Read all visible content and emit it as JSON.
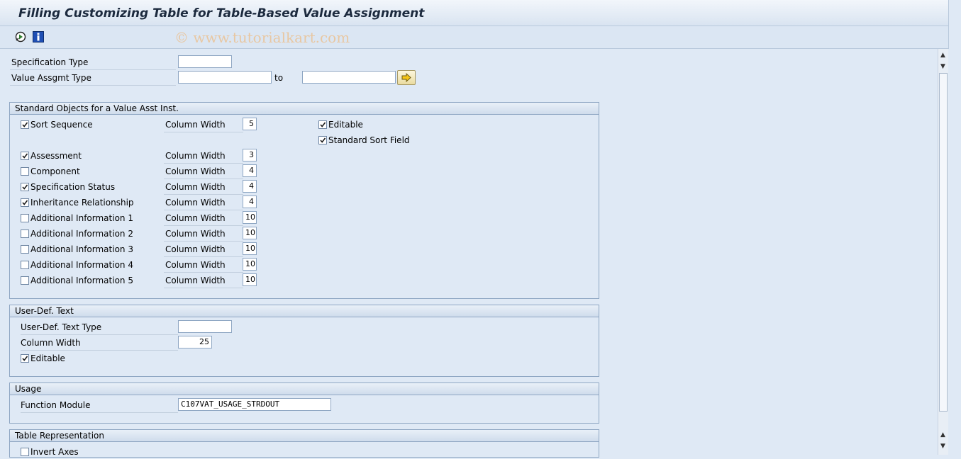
{
  "title": "Filling Customizing Table for Table-Based Value Assignment",
  "watermark": "© www.tutorialkart.com",
  "toolbar": {
    "icons": [
      "execute-icon",
      "info-icon"
    ]
  },
  "selection": {
    "spec_type_label": "Specification Type",
    "spec_type_value": "",
    "value_assgmt_label": "Value Assgmt Type",
    "value_assgmt_from": "",
    "to_label": "to",
    "value_assgmt_to": ""
  },
  "standard_objects": {
    "heading": "Standard Objects for a Value Asst Inst.",
    "col_width_label": "Column Width",
    "editable_label": "Editable",
    "editable_checked": true,
    "std_sort_label": "Standard Sort Field",
    "std_sort_checked": true,
    "items": [
      {
        "label": "Sort Sequence",
        "checked": true,
        "width": "5"
      },
      {
        "label": "Assessment",
        "checked": true,
        "width": "3"
      },
      {
        "label": "Component",
        "checked": false,
        "width": "4"
      },
      {
        "label": "Specification Status",
        "checked": true,
        "width": "4"
      },
      {
        "label": "Inheritance Relationship",
        "checked": true,
        "width": "4"
      },
      {
        "label": "Additional Information 1",
        "checked": false,
        "width": "10"
      },
      {
        "label": "Additional Information 2",
        "checked": false,
        "width": "10"
      },
      {
        "label": "Additional Information 3",
        "checked": false,
        "width": "10"
      },
      {
        "label": "Additional Information 4",
        "checked": false,
        "width": "10"
      },
      {
        "label": "Additional Information 5",
        "checked": false,
        "width": "10"
      }
    ]
  },
  "user_text": {
    "heading": "User-Def. Text",
    "type_label": "User-Def. Text Type",
    "type_value": "",
    "width_label": "Column Width",
    "width_value": "25",
    "editable_label": "Editable",
    "editable_checked": true
  },
  "usage": {
    "heading": "Usage",
    "fm_label": "Function Module",
    "fm_value": "C107VAT_USAGE_STRDOUT"
  },
  "table_rep": {
    "heading": "Table Representation",
    "invert_label": "Invert Axes",
    "invert_checked": false
  }
}
